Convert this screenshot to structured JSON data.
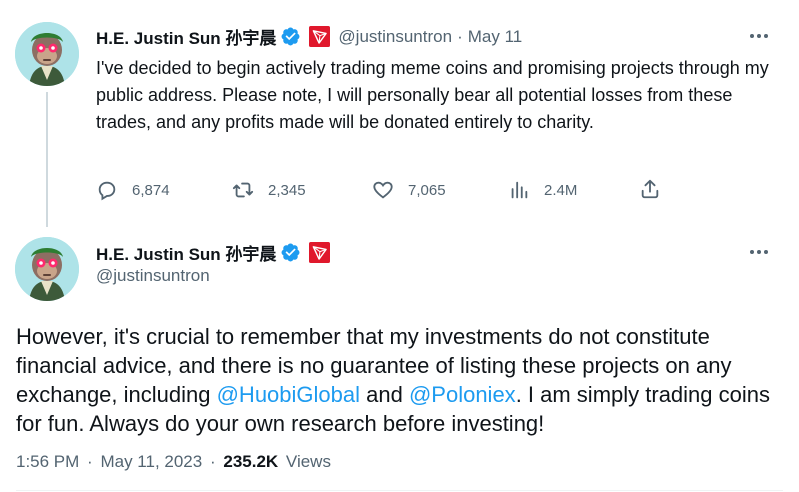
{
  "tweet1": {
    "author_name": "H.E. Justin Sun 孙宇晨",
    "handle": "@justinsuntron",
    "separator": "·",
    "date": "May 11",
    "text": "I've decided to begin actively trading meme coins and promising projects through my public address. Please note, I will personally bear all potential losses from these trades, and any profits made will be donated entirely to charity.",
    "actions": {
      "replies": "6,874",
      "retweets": "2,345",
      "likes": "7,065",
      "views": "2.4M"
    }
  },
  "tweet2": {
    "author_name": "H.E. Justin Sun 孙宇晨",
    "handle": "@justinsuntron",
    "text_part1": "However, it's crucial to remember that my investments do not constitute financial advice, and there is no guarantee of listing these projects on any exchange, including ",
    "mention1": "@HuobiGlobal",
    "text_part2": " and ",
    "mention2": "@Poloniex",
    "text_part3": ". I am simply trading coins for fun. Always do your own research before investing!",
    "meta": {
      "time": "1:56 PM",
      "separator": "·",
      "date": "May 11, 2023",
      "views_count": "235.2K",
      "views_label": "Views"
    }
  },
  "colors": {
    "accent": "#1d9bf0",
    "secondary_text": "#536471",
    "tron_red": "#e0182c",
    "avatar_bg": "#aee3e8"
  }
}
